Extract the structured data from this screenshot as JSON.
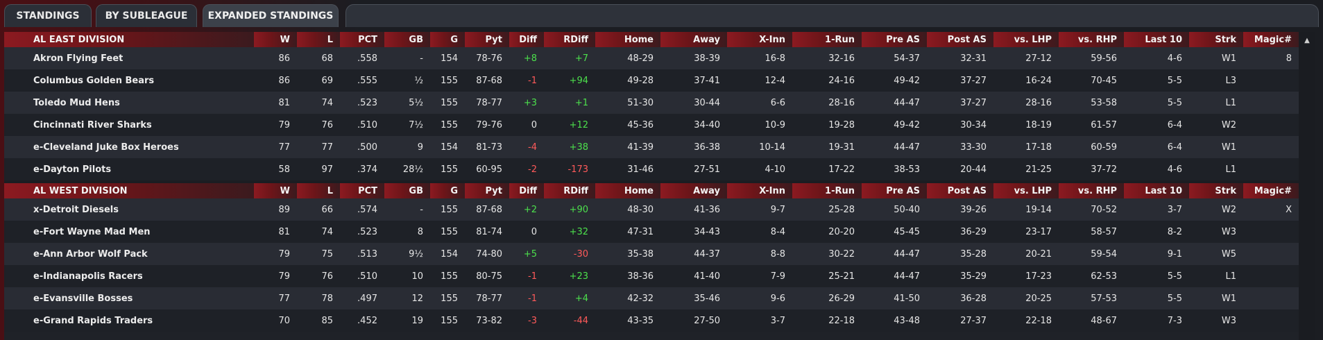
{
  "tabs": [
    "STANDINGS",
    "BY SUBLEAGUE",
    "EXPANDED STANDINGS"
  ],
  "columns": [
    "W",
    "L",
    "PCT",
    "GB",
    "G",
    "Pyt",
    "Diff",
    "RDiff",
    "Home",
    "Away",
    "X-Inn",
    "1-Run",
    "Pre AS",
    "Post AS",
    "vs. LHP",
    "vs. RHP",
    "Last 10",
    "Strk",
    "Magic#"
  ],
  "divisions": [
    {
      "name": "AL EAST DIVISION",
      "teams": [
        [
          "Akron  Flying Feet",
          "86",
          "68",
          ".558",
          "-",
          "154",
          "78-76",
          "+8",
          "+7",
          "48-29",
          "38-39",
          "16-8",
          "32-16",
          "54-37",
          "32-31",
          "27-12",
          "59-56",
          "4-6",
          "W1",
          "8"
        ],
        [
          "Columbus Golden Bears",
          "86",
          "69",
          ".555",
          "½",
          "155",
          "87-68",
          "-1",
          "+94",
          "49-28",
          "37-41",
          "12-4",
          "24-16",
          "49-42",
          "37-27",
          "16-24",
          "70-45",
          "5-5",
          "L3",
          ""
        ],
        [
          "Toledo  Mud Hens",
          "81",
          "74",
          ".523",
          "5½",
          "155",
          "78-77",
          "+3",
          "+1",
          "51-30",
          "30-44",
          "6-6",
          "28-16",
          "44-47",
          "37-27",
          "28-16",
          "53-58",
          "5-5",
          "L1",
          ""
        ],
        [
          "Cincinnati River Sharks",
          "79",
          "76",
          ".510",
          "7½",
          "155",
          "79-76",
          "0",
          "+12",
          "45-36",
          "34-40",
          "10-9",
          "19-28",
          "49-42",
          "30-34",
          "18-19",
          "61-57",
          "6-4",
          "W2",
          ""
        ],
        [
          "e-Cleveland Juke Box Heroes",
          "77",
          "77",
          ".500",
          "9",
          "154",
          "81-73",
          "-4",
          "+38",
          "41-39",
          "36-38",
          "10-14",
          "19-31",
          "44-47",
          "33-30",
          "17-18",
          "60-59",
          "6-4",
          "W1",
          ""
        ],
        [
          "e-Dayton Pilots",
          "58",
          "97",
          ".374",
          "28½",
          "155",
          "60-95",
          "-2",
          "-173",
          "31-46",
          "27-51",
          "4-10",
          "17-22",
          "38-53",
          "20-44",
          "21-25",
          "37-72",
          "4-6",
          "L1",
          ""
        ]
      ]
    },
    {
      "name": "AL WEST DIVISION",
      "teams": [
        [
          "x-Detroit Diesels",
          "89",
          "66",
          ".574",
          "-",
          "155",
          "87-68",
          "+2",
          "+90",
          "48-30",
          "41-36",
          "9-7",
          "25-28",
          "50-40",
          "39-26",
          "19-14",
          "70-52",
          "3-7",
          "W2",
          "X"
        ],
        [
          "e-Fort Wayne Mad Men",
          "81",
          "74",
          ".523",
          "8",
          "155",
          "81-74",
          "0",
          "+32",
          "47-31",
          "34-43",
          "8-4",
          "20-20",
          "45-45",
          "36-29",
          "23-17",
          "58-57",
          "8-2",
          "W3",
          ""
        ],
        [
          "e-Ann Arbor Wolf Pack",
          "79",
          "75",
          ".513",
          "9½",
          "154",
          "74-80",
          "+5",
          "-30",
          "35-38",
          "44-37",
          "8-8",
          "30-22",
          "44-47",
          "35-28",
          "20-21",
          "59-54",
          "9-1",
          "W5",
          ""
        ],
        [
          "e-Indianapolis Racers",
          "79",
          "76",
          ".510",
          "10",
          "155",
          "80-75",
          "-1",
          "+23",
          "38-36",
          "41-40",
          "7-9",
          "25-21",
          "44-47",
          "35-29",
          "17-23",
          "62-53",
          "5-5",
          "L1",
          ""
        ],
        [
          "e-Evansville Bosses",
          "77",
          "78",
          ".497",
          "12",
          "155",
          "78-77",
          "-1",
          "+4",
          "42-32",
          "35-46",
          "9-6",
          "26-29",
          "41-50",
          "36-28",
          "20-25",
          "57-53",
          "5-5",
          "W1",
          ""
        ],
        [
          "e-Grand Rapids Traders",
          "70",
          "85",
          ".452",
          "19",
          "155",
          "73-82",
          "-3",
          "-44",
          "43-35",
          "27-50",
          "3-7",
          "22-18",
          "43-48",
          "27-37",
          "22-18",
          "48-67",
          "7-3",
          "W3",
          ""
        ]
      ]
    }
  ],
  "colors": {
    "header_red": "#8c1a21",
    "positive": "#4ce04c",
    "negative": "#ff5a5a"
  },
  "icons": {
    "scroll_up": "triangle-up-icon"
  }
}
